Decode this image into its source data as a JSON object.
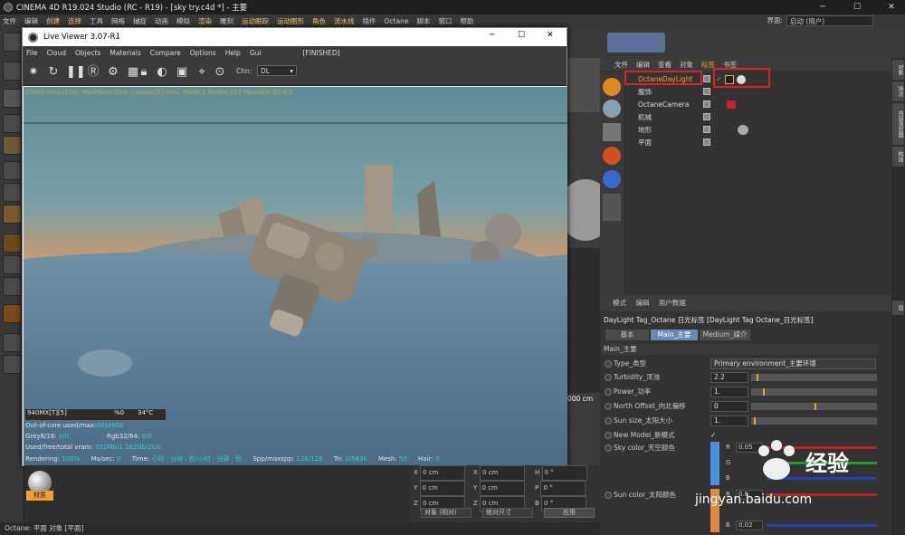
{
  "window": {
    "title": "CINEMA 4D R19.024 Studio (RC - R19) - [sky try.c4d *] - 主要",
    "min": "─",
    "max": "☐",
    "close": "✕"
  },
  "menubar": [
    "文件",
    "编辑",
    "创建",
    "选择",
    "工具",
    "网格",
    "捕捉",
    "动画",
    "模拟",
    "渲染",
    "雕刻",
    "运动跟踪",
    "运动图形",
    "角色",
    "流水线",
    "插件",
    "Octane",
    "脚本",
    "窗口",
    "帮助"
  ],
  "layout": {
    "label": "界面:",
    "value": "启动 (用户)"
  },
  "liveviewer": {
    "title": "Live Viewer 3.07-R1",
    "menu": [
      "File",
      "Cloud",
      "Objects",
      "Materials",
      "Compare",
      "Options",
      "Help",
      "Gui"
    ],
    "status": "[FINISHED]",
    "chn_label": "Chn:",
    "chn_value": "DL",
    "overlay": "Check:0ms./1ms. MeshGen:0ms. Update[E]:0ms. Mesh:1 Nodes:117 Movable:50  0 0",
    "stats": {
      "gpu": "940MX[T][5]",
      "pct": "%0",
      "temp": "34°C",
      "outofcore_label": "Out-of-core used/max:",
      "outofcore_val": "0Kb/4Gb",
      "grey_label": "Grey8/16:",
      "grey_val": "0/0",
      "rgb_label": "Rgb32/64:",
      "rgb_val": "0/0",
      "vram_label": "Used/free/total vram:",
      "vram_val": "352Mb/1.182Gb/2Gb",
      "rendering_label": "Rendering:",
      "rendering_val": "100%",
      "ms_label": "Ms/sec:",
      "ms_val": "0",
      "time_label": "Time:",
      "time_val": "小时 : 分钟 : 秒/小时 : 分钟 : 秒",
      "spp_label": "Spp/maxspp:",
      "spp_val": "128/128",
      "tri_label": "Tri:",
      "tri_val": "0/583k",
      "mesh_label": "Mesh:",
      "mesh_val": "50",
      "hair_label": "Hair:",
      "hair_val": "0"
    }
  },
  "objects": {
    "menu": [
      "文件",
      "编辑",
      "查看",
      "对象",
      "标签",
      "书签"
    ],
    "active_menu": "标签",
    "rows": [
      {
        "name": "OctaneDayLight"
      },
      {
        "name": "腹饰"
      },
      {
        "name": "OctaneCamera"
      },
      {
        "name": "机械"
      },
      {
        "name": "地形"
      },
      {
        "name": "平面"
      }
    ]
  },
  "right_tabs": [
    "对象",
    "场次",
    "内容浏览器",
    "构造",
    "层"
  ],
  "attributes": {
    "menu": [
      "模式",
      "编辑",
      "用户数据"
    ],
    "header": "DayLight Tag_Octane 日光标签 [DayLight Tag Octane_日光标签]",
    "tabs": [
      "基本",
      "Main_主要",
      "Medium_媒介"
    ],
    "section": "Main_主要",
    "type_label": "Type_类型",
    "type_value": "Primary environment_主要环境",
    "turbidity_label": "Turbidity_浑浊",
    "turbidity_value": "2.2",
    "turbidity_fill": 0.04,
    "power_label": "Power_功率",
    "power_value": "1.",
    "power_fill": 0.09,
    "north_label": "North Offset_向北偏移",
    "north_value": "0",
    "north_fill": 0.5,
    "sunsize_label": "Sun size_太阳大小",
    "sunsize_value": "1.",
    "sunsize_fill": 0.02,
    "newmodel_label": "New Model_新模式",
    "newmodel_check": "✓",
    "sky_label": "Sky color_天空颜色",
    "sky_r": "0.05",
    "sun_label": "Sun color_太阳颜色",
    "sun_r": "0.6",
    "sun_b": "0.02",
    "r": "R",
    "g": "G",
    "b": "B"
  },
  "coords": {
    "x": "X",
    "y": "Y",
    "z": "Z",
    "h": "H",
    "p": "P",
    "bb": "B",
    "cm": "0 cm",
    "deg": "0 °",
    "mode1": "对象 (相对)",
    "mode2": "绝对尺寸",
    "apply": "应用",
    "ruler": "000 cm"
  },
  "material": {
    "label": "材质"
  },
  "status": {
    "text": "Octane:     平面 对象 [平面]"
  },
  "watermark": {
    "brand": "Baidu",
    "cn": "经验",
    "url": "jingyan.baidu.com"
  }
}
